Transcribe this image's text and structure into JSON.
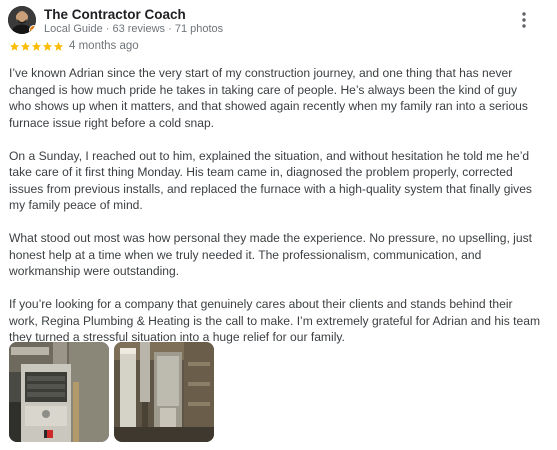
{
  "review": {
    "reviewer_name": "The Contractor Coach",
    "reviewer_meta": "Local Guide · 63 reviews · 71 photos",
    "rating": 5,
    "max_rating": 5,
    "time_ago": "4 months ago",
    "paragraphs": [
      "I’ve known Adrian since the very start of my construction journey, and one thing that has never changed is how much pride he takes in taking care of people. He’s always been the kind of guy who shows up when it matters, and that showed again recently when my family ran into a serious furnace issue right before a cold snap.",
      "On a Sunday, I reached out to him, explained the situation, and without hesitation he told me he’d take care of it first thing Monday. His team came in, diagnosed the problem properly, corrected issues from previous installs, and replaced the furnace with a high-quality system that finally gives my family peace of mind.",
      "What stood out most was how personal they made the experience. No pressure, no upselling, just honest help at a time when we truly needed it. The professionalism, communication, and workmanship were outstanding.",
      "If you’re looking for a company that genuinely cares about their clients and stands behind their work, Regina Plumbing & Heating is the call to make. I’m extremely grateful for Adrian and his team they turned a stressful situation into a huge relief for our family."
    ],
    "photos": [
      {
        "icon": "furnace-photo"
      },
      {
        "icon": "ductwork-photo"
      }
    ]
  },
  "colors": {
    "star": "#fbbc04",
    "name": "#202124",
    "meta": "#70757a",
    "body": "#3c4043",
    "guide_badge": "#e37400"
  },
  "icons": {
    "more": "more-vert-icon",
    "star": "star-icon",
    "guide": "local-guide-badge-icon"
  }
}
